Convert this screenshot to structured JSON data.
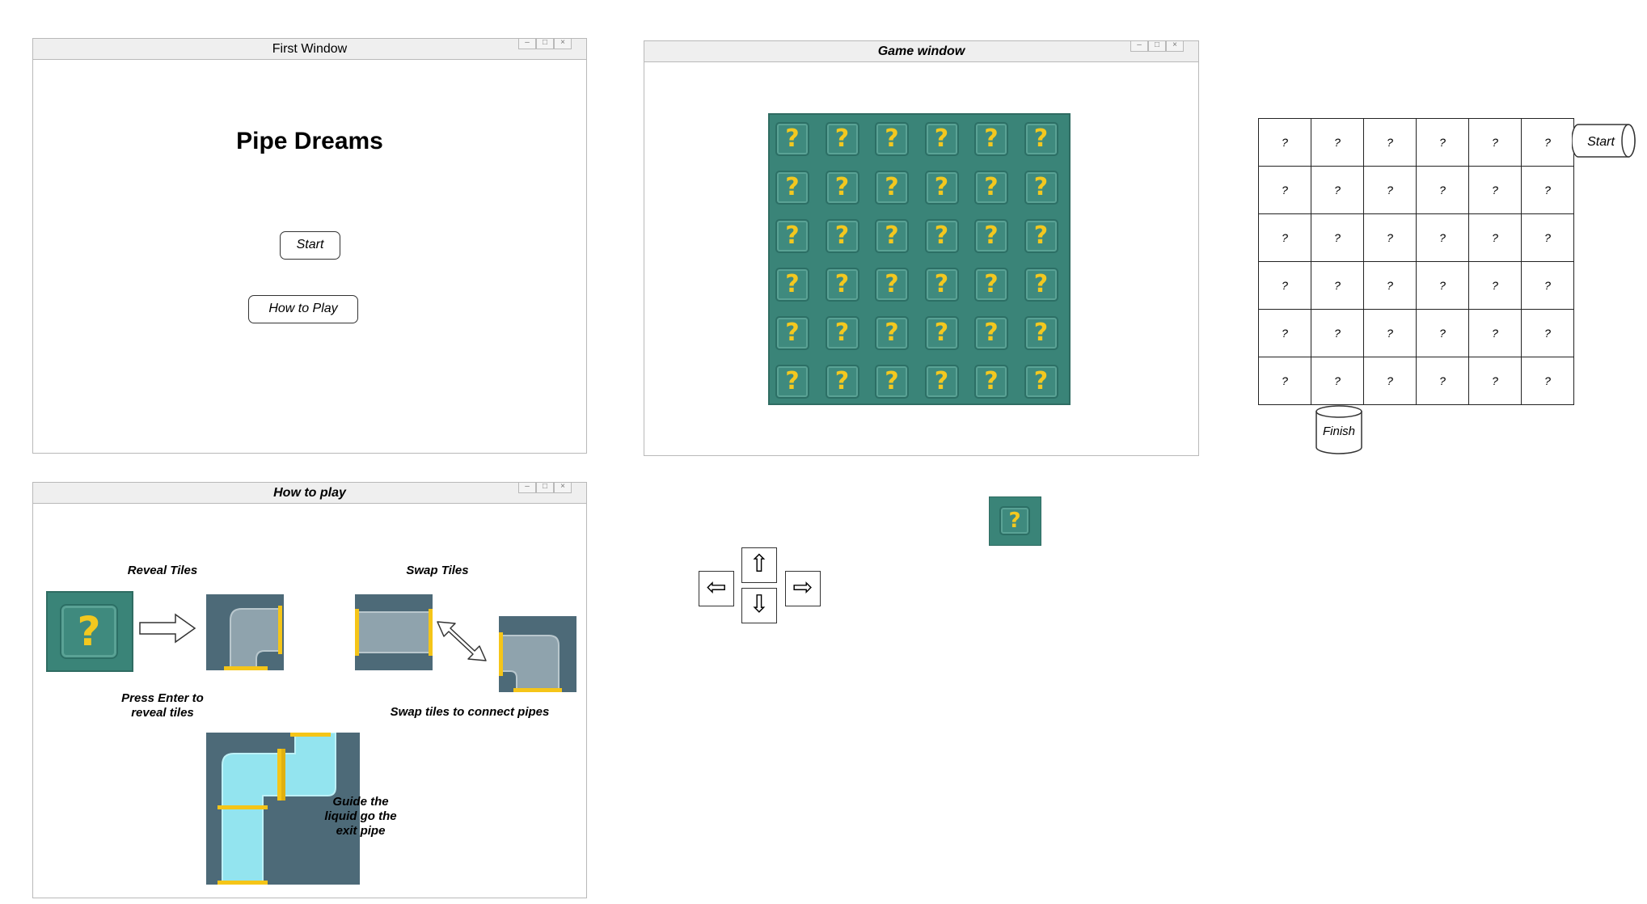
{
  "first_window": {
    "title": "First Window",
    "heading": "Pipe Dreams",
    "start_label": "Start",
    "howto_label": "How to Play",
    "controls": [
      "–",
      "□",
      "×"
    ]
  },
  "game_window": {
    "title": "Game window",
    "tile_glyph": "?",
    "rows": 6,
    "cols": 6,
    "controls": [
      "–",
      "□",
      "×"
    ]
  },
  "howto_window": {
    "title": "How to play",
    "reveal_title": "Reveal Tiles",
    "reveal_caption_1": "Press Enter to",
    "reveal_caption_2": "reveal tiles",
    "swap_title": "Swap Tiles",
    "swap_caption": "Swap tiles to connect pipes",
    "guide_1": "Guide the",
    "guide_2": "liquid go the",
    "guide_3": "exit pipe",
    "tile_glyph": "?",
    "controls": [
      "–",
      "□",
      "×"
    ]
  },
  "sketch_grid": {
    "cell_text": "?",
    "start_label": "Start",
    "finish_label": "Finish"
  },
  "arrow_keys": {
    "up": "⇧",
    "down": "⇩",
    "left": "⇦",
    "right": "⇨"
  },
  "colors": {
    "board": "#3a8478",
    "question": "#f3c81f",
    "pipe_bg": "#4d6a78",
    "pipe_gray": "#8fa3ad",
    "pipe_liquid": "#93e4ef",
    "connector": "#f5c518"
  }
}
